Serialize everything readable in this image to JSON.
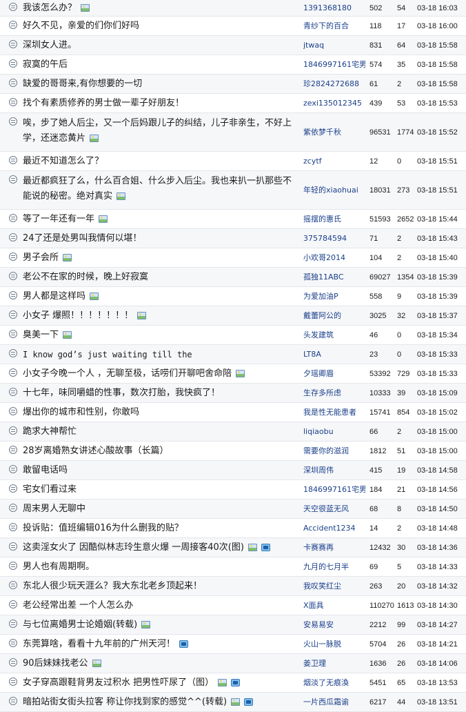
{
  "topics": [
    {
      "title": "我该怎么办？",
      "author": "1391368180",
      "replies": "502",
      "views": "54",
      "date": "03-18 16:03",
      "icons": [
        "image"
      ]
    },
    {
      "title": "好久不见，亲爱的们你们好吗",
      "author": "青纱下的百合",
      "replies": "118",
      "views": "17",
      "date": "03-18 16:00",
      "icons": []
    },
    {
      "title": "深圳女人进。",
      "author": "jtwaq",
      "replies": "831",
      "views": "64",
      "date": "03-18 15:58",
      "icons": []
    },
    {
      "title": "寂寞的午后",
      "author": "1846997161宅男",
      "replies": "574",
      "views": "35",
      "date": "03-18 15:58",
      "icons": []
    },
    {
      "title": "缺爱的哥哥来,有你想要的一切",
      "author": "珍2824272688",
      "replies": "61",
      "views": "2",
      "date": "03-18 15:58",
      "icons": []
    },
    {
      "title": "找个有素质修养的男士做一辈子好朋友！",
      "author": "zexi135012345",
      "replies": "439",
      "views": "53",
      "date": "03-18 15:53",
      "icons": []
    },
    {
      "title": "唉，步了她人后尘，又一个后妈跟儿子的纠结，儿子非亲生，不好上学，还迷恋黄片",
      "author": "紫依梦千秋",
      "replies": "96531",
      "views": "1774",
      "date": "03-18 15:52",
      "icons": [
        "image"
      ],
      "tall": true
    },
    {
      "title": "最近不知道怎么了？",
      "author": "zcytf",
      "replies": "12",
      "views": "0",
      "date": "03-18 15:51",
      "icons": []
    },
    {
      "title": "最近都疯狂了么，什么百合姐、什么步入后尘。我也来扒一扒那些不能说的秘密。绝对真实",
      "author": "年轻的xiaohuai",
      "replies": "18031",
      "views": "273",
      "date": "03-18 15:51",
      "icons": [
        "image"
      ],
      "tall": true
    },
    {
      "title": "等了一年还有一年",
      "author": "摇摆的惠氏",
      "replies": "51593",
      "views": "2652",
      "date": "03-18 15:44",
      "icons": [
        "image"
      ]
    },
    {
      "title": "24了还是处男叫我情何以堪！",
      "author": "375784594",
      "replies": "71",
      "views": "2",
      "date": "03-18 15:43",
      "icons": []
    },
    {
      "title": "男子会所",
      "author": "小欢哥2014",
      "replies": "104",
      "views": "2",
      "date": "03-18 15:40",
      "icons": [
        "image"
      ]
    },
    {
      "title": "老公不在家的时候，晚上好寂寞",
      "author": "孤独11ABC",
      "replies": "69027",
      "views": "1354",
      "date": "03-18 15:39",
      "icons": []
    },
    {
      "title": "男人都是这样吗",
      "author": "为爱加油P",
      "replies": "558",
      "views": "9",
      "date": "03-18 15:39",
      "icons": [
        "image"
      ]
    },
    {
      "title": "小女子 爆照！！！！！！！",
      "author": "戴蕾阿公的",
      "replies": "3025",
      "views": "32",
      "date": "03-18 15:37",
      "icons": [
        "image"
      ]
    },
    {
      "title": "臭美一下",
      "author": "头发建筑",
      "replies": "46",
      "views": "0",
      "date": "03-18 15:34",
      "icons": [
        "image"
      ]
    },
    {
      "title": "I know god’s just waiting till the",
      "author": "LT8A",
      "replies": "23",
      "views": "0",
      "date": "03-18 15:33",
      "icons": [],
      "mono": true
    },
    {
      "title": "小女子今晚一个人 ，无聊至极，话唠们开聊吧舍命陪",
      "author": "夕瑶卿眉",
      "replies": "53392",
      "views": "729",
      "date": "03-18 15:33",
      "icons": [
        "image"
      ]
    },
    {
      "title": "十七年，味同嚼蜡的性事，数次打胎，我快疯了！",
      "author": "生存多所虑",
      "replies": "10333",
      "views": "39",
      "date": "03-18 15:09",
      "icons": []
    },
    {
      "title": "爆出你的城市和性别，你敢吗",
      "author": "我是性无能患者",
      "replies": "15741",
      "views": "854",
      "date": "03-18 15:02",
      "icons": []
    },
    {
      "title": "跪求大神帮忙",
      "author": "liqiaobu",
      "replies": "66",
      "views": "2",
      "date": "03-18 15:00",
      "icons": []
    },
    {
      "title": "28岁离婚熟女讲述心酸故事（长篇）",
      "author": "需要你的滋润",
      "replies": "1812",
      "views": "51",
      "date": "03-18 15:00",
      "icons": []
    },
    {
      "title": "敢留电话吗",
      "author": "深圳周伟",
      "replies": "415",
      "views": "19",
      "date": "03-18 14:58",
      "icons": []
    },
    {
      "title": "宅女们看过来",
      "author": "1846997161宅男",
      "replies": "184",
      "views": "21",
      "date": "03-18 14:56",
      "icons": []
    },
    {
      "title": "周末男人无聊中",
      "author": "天空很蓝无风",
      "replies": "68",
      "views": "8",
      "date": "03-18 14:50",
      "icons": []
    },
    {
      "title": "投诉贴：值班编辑016为什么删我的贴？",
      "author": "Accident1234",
      "replies": "14",
      "views": "2",
      "date": "03-18 14:48",
      "icons": []
    },
    {
      "title": "这卖淫女火了 因酷似林志玲生意火爆 一周接客40次(图)",
      "author": "卡赛赛再",
      "replies": "12432",
      "views": "30",
      "date": "03-18 14:36",
      "icons": [
        "image",
        "video"
      ]
    },
    {
      "title": "男人也有周期啊。",
      "author": "九月的七月半",
      "replies": "69",
      "views": "5",
      "date": "03-18 14:33",
      "icons": []
    },
    {
      "title": "东北人很少玩天涯么？我大东北老乡顶起来！",
      "author": "我叹笑红尘",
      "replies": "263",
      "views": "20",
      "date": "03-18 14:32",
      "icons": []
    },
    {
      "title": "老公经常出差 一个人怎么办",
      "author": "X面具",
      "replies": "110270",
      "views": "1613",
      "date": "03-18 14:30",
      "icons": []
    },
    {
      "title": "与七位离婚男士论婚姻(转载)",
      "author": "安易易安",
      "replies": "2212",
      "views": "99",
      "date": "03-18 14:27",
      "icons": [
        "image"
      ]
    },
    {
      "title": "东莞算啥，看看十九年前的广州天河！",
      "author": "火山一脉脱",
      "replies": "5704",
      "views": "26",
      "date": "03-18 14:21",
      "icons": [
        "video"
      ]
    },
    {
      "title": "90后妹妹找老公",
      "author": "姜卫理",
      "replies": "1636",
      "views": "26",
      "date": "03-18 14:06",
      "icons": [
        "image"
      ]
    },
    {
      "title": "女子穿高跟鞋背男友过积水 把男性吓尿了（图）",
      "author": "烟淡了无痕渙",
      "replies": "5451",
      "views": "65",
      "date": "03-18 13:53",
      "icons": [
        "image",
        "video"
      ]
    },
    {
      "title": "暗拍站街女街头拉客 称让你找到家的感觉^^(转载)",
      "author": "一片西瓜霜谕",
      "replies": "6217",
      "views": "44",
      "date": "03-18 13:51",
      "icons": [
        "image",
        "video"
      ]
    }
  ]
}
